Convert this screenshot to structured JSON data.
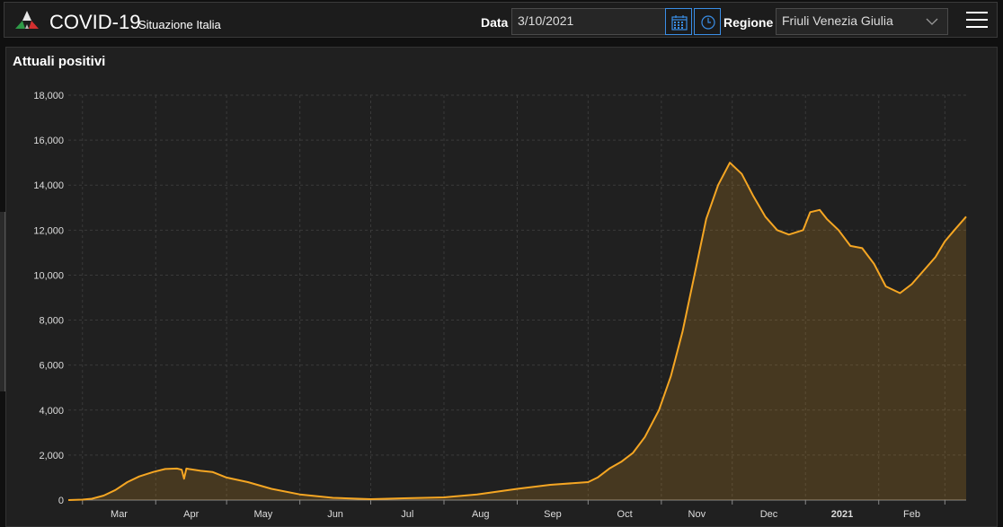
{
  "header": {
    "title": "COVID-19",
    "subtitle": "Situazione Italia",
    "date_label": "Data",
    "date_value": "3/10/2021",
    "region_label": "Regione",
    "region_value": "Friuli Venezia Giulia"
  },
  "icons": {
    "logo": "tricolor-drop-logo",
    "calendar": "calendar-icon",
    "clock": "clock-icon",
    "dropdown": "chevron-down-icon",
    "menu": "hamburger-menu-icon"
  },
  "colors": {
    "accent": "#3a8ee6",
    "series": "#f5a623"
  },
  "panel": {
    "title": "Attuali positivi"
  },
  "chart_data": {
    "type": "area",
    "title": "Attuali positivi",
    "xlabel": "",
    "ylabel": "",
    "ylim": [
      0,
      18000
    ],
    "yticks": [
      0,
      2000,
      4000,
      6000,
      8000,
      10000,
      12000,
      14000,
      16000,
      18000
    ],
    "xticks": [
      "Mar",
      "Apr",
      "May",
      "Jun",
      "Jul",
      "Aug",
      "Sep",
      "Oct",
      "Nov",
      "Dec",
      "2021",
      "Feb"
    ],
    "xlim": [
      "2020-02-24",
      "2021-03-10"
    ],
    "grid": true,
    "series": [
      {
        "x": [
          "2020-02-24",
          "2020-03-01",
          "2020-03-05",
          "2020-03-10",
          "2020-03-15",
          "2020-03-20",
          "2020-03-25",
          "2020-03-31",
          "2020-04-05",
          "2020-04-10",
          "2020-04-12",
          "2020-04-13",
          "2020-04-14",
          "2020-04-15",
          "2020-04-20",
          "2020-04-25",
          "2020-05-01",
          "2020-05-10",
          "2020-05-20",
          "2020-06-01",
          "2020-06-15",
          "2020-07-01",
          "2020-07-15",
          "2020-08-01",
          "2020-08-15",
          "2020-09-01",
          "2020-09-15",
          "2020-10-01",
          "2020-10-05",
          "2020-10-10",
          "2020-10-15",
          "2020-10-20",
          "2020-10-25",
          "2020-10-31",
          "2020-11-05",
          "2020-11-10",
          "2020-11-15",
          "2020-11-20",
          "2020-11-25",
          "2020-11-30",
          "2020-12-05",
          "2020-12-10",
          "2020-12-15",
          "2020-12-20",
          "2020-12-25",
          "2020-12-31",
          "2021-01-03",
          "2021-01-07",
          "2021-01-10",
          "2021-01-15",
          "2021-01-20",
          "2021-01-25",
          "2021-01-30",
          "2021-02-04",
          "2021-02-10",
          "2021-02-15",
          "2021-02-20",
          "2021-02-25",
          "2021-03-01",
          "2021-03-05",
          "2021-03-10"
        ],
        "values": [
          0,
          20,
          60,
          200,
          450,
          800,
          1050,
          1250,
          1380,
          1400,
          1350,
          950,
          1400,
          1380,
          1300,
          1250,
          1000,
          800,
          500,
          250,
          100,
          40,
          80,
          120,
          250,
          500,
          680,
          800,
          1000,
          1400,
          1700,
          2100,
          2800,
          4000,
          5500,
          7500,
          10000,
          12500,
          14000,
          15000,
          14500,
          13500,
          12600,
          12000,
          11800,
          12000,
          12800,
          12900,
          12500,
          12000,
          11300,
          11200,
          10500,
          9500,
          9200,
          9600,
          10200,
          10800,
          11500,
          12000,
          12600
        ]
      }
    ]
  }
}
